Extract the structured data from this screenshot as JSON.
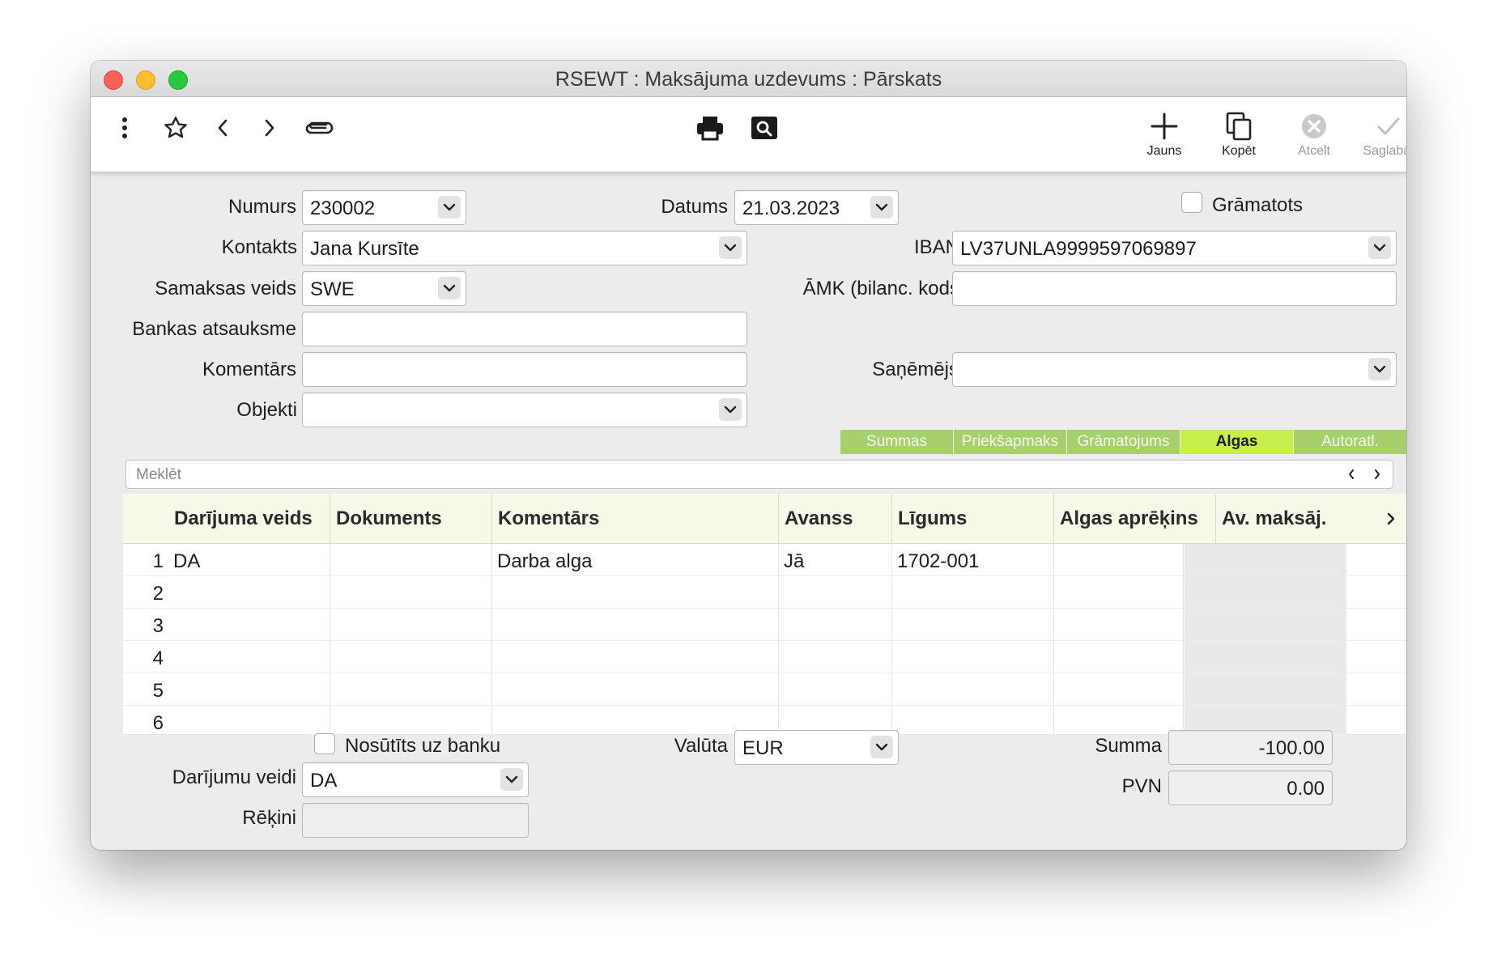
{
  "window": {
    "title": "RSEWT : Maksājuma uzdevums : Pārskats"
  },
  "toolbar": {
    "new_label": "Jauns",
    "copy_label": "Kopēt",
    "cancel_label": "Atcelt",
    "save_label": "Saglabāt"
  },
  "form": {
    "numurs_label": "Numurs",
    "numurs_value": "230002",
    "datums_label": "Datums",
    "datums_value": "21.03.2023",
    "gramatots_label": "Grāmatots",
    "kontakts_label": "Kontakts",
    "kontakts_value": "Jana Kursīte",
    "iban_label": "IBAN",
    "iban_value": "LV37UNLA9999597069897",
    "samaksas_label": "Samaksas veids",
    "samaksas_value": "SWE",
    "amk_label": "ĀMK (bilanc. kods",
    "amk_value": "",
    "bankas_label": "Bankas atsauksme",
    "bankas_value": "",
    "komentars_label": "Komentārs",
    "komentars_value": "",
    "sanemejs_label": "Saņēmējs",
    "sanemejs_value": "",
    "objekti_label": "Objekti",
    "objekti_value": ""
  },
  "tabs": [
    "Summas",
    "Priekšapmaks",
    "Grāmatojums",
    "Algas",
    "Autoratl."
  ],
  "active_tab": "Algas",
  "search": {
    "placeholder": "Meklēt"
  },
  "table": {
    "columns": [
      "Darījuma veids",
      "Dokuments",
      "Komentārs",
      "Avanss",
      "Līgums",
      "Algas aprēķins",
      "Av. maksāj."
    ],
    "rows": [
      {
        "n": "1",
        "cells": [
          "DA",
          "",
          "Darba alga",
          "Jā",
          "1702-001",
          "",
          ""
        ]
      },
      {
        "n": "2",
        "cells": [
          "",
          "",
          "",
          "",
          "",
          "",
          ""
        ]
      },
      {
        "n": "3",
        "cells": [
          "",
          "",
          "",
          "",
          "",
          "",
          ""
        ]
      },
      {
        "n": "4",
        "cells": [
          "",
          "",
          "",
          "",
          "",
          "",
          ""
        ]
      },
      {
        "n": "5",
        "cells": [
          "",
          "",
          "",
          "",
          "",
          "",
          ""
        ]
      },
      {
        "n": "6",
        "cells": [
          "",
          "",
          "",
          "",
          "",
          "",
          ""
        ]
      }
    ]
  },
  "footer": {
    "nosutits_label": "Nosūtīts uz banku",
    "valuta_label": "Valūta",
    "valuta_value": "EUR",
    "summa_label": "Summa",
    "summa_value": "-100.00",
    "pvn_label": "PVN",
    "pvn_value": "0.00",
    "darijumu_label": "Darījumu veidi",
    "darijumu_value": "DA",
    "rekini_label": "Rēķini",
    "rekini_value": ""
  }
}
